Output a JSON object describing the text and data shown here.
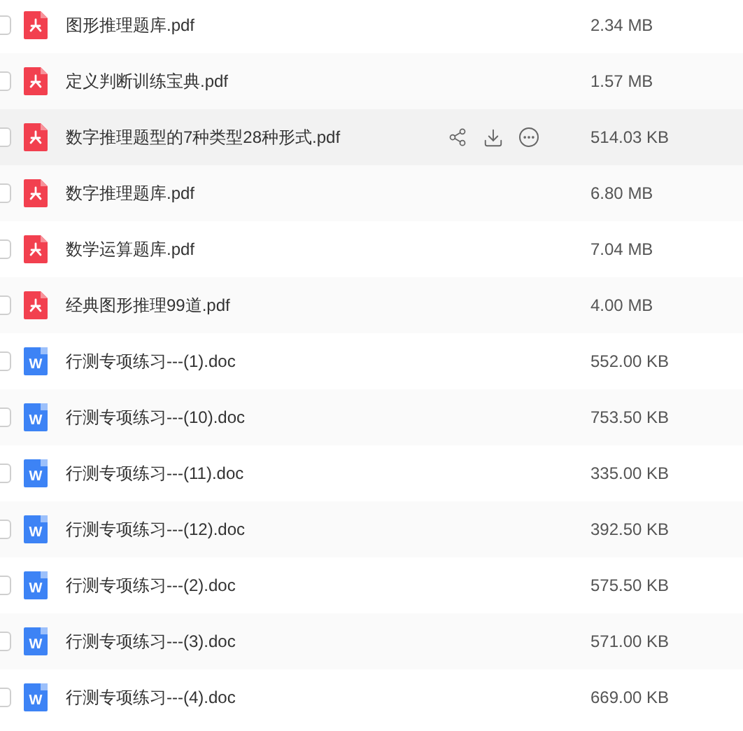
{
  "files": [
    {
      "kind": "pdf",
      "name": "图形推理题库.pdf",
      "size": "2.34 MB",
      "checked": false,
      "hovered": false
    },
    {
      "kind": "pdf",
      "name": "定义判断训练宝典.pdf",
      "size": "1.57 MB",
      "checked": false,
      "hovered": false
    },
    {
      "kind": "pdf",
      "name": "数字推理题型的7种类型28种形式.pdf",
      "size": "514.03 KB",
      "checked": false,
      "hovered": true
    },
    {
      "kind": "pdf",
      "name": "数字推理题库.pdf",
      "size": "6.80 MB",
      "checked": false,
      "hovered": false
    },
    {
      "kind": "pdf",
      "name": "数学运算题库.pdf",
      "size": "7.04 MB",
      "checked": false,
      "hovered": false
    },
    {
      "kind": "pdf",
      "name": "经典图形推理99道.pdf",
      "size": "4.00 MB",
      "checked": false,
      "hovered": false
    },
    {
      "kind": "doc",
      "badge": "W",
      "name": "行测专项练习---(1).doc",
      "size": "552.00 KB",
      "checked": false,
      "hovered": false
    },
    {
      "kind": "doc",
      "badge": "W",
      "name": "行测专项练习---(10).doc",
      "size": "753.50 KB",
      "checked": false,
      "hovered": false
    },
    {
      "kind": "doc",
      "badge": "W",
      "name": "行测专项练习---(11).doc",
      "size": "335.00 KB",
      "checked": false,
      "hovered": false
    },
    {
      "kind": "doc",
      "badge": "W",
      "name": "行测专项练习---(12).doc",
      "size": "392.50 KB",
      "checked": false,
      "hovered": false
    },
    {
      "kind": "doc",
      "badge": "W",
      "name": "行测专项练习---(2).doc",
      "size": "575.50 KB",
      "checked": false,
      "hovered": false
    },
    {
      "kind": "doc",
      "badge": "W",
      "name": "行测专项练习---(3).doc",
      "size": "571.00 KB",
      "checked": false,
      "hovered": false
    },
    {
      "kind": "doc",
      "badge": "W",
      "name": "行测专项练习---(4).doc",
      "size": "669.00 KB",
      "checked": false,
      "hovered": false
    }
  ]
}
